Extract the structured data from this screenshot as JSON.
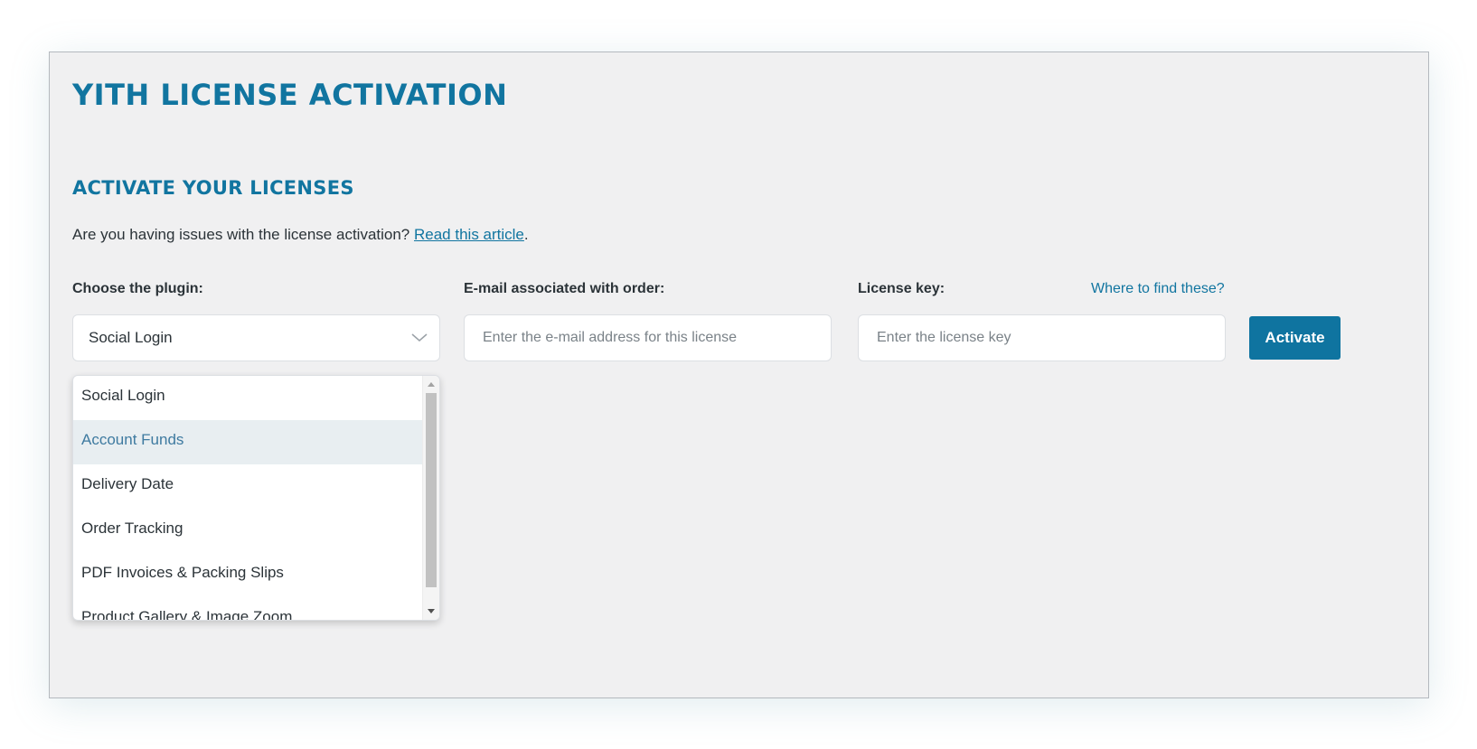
{
  "page": {
    "title": "YITH LICENSE ACTIVATION",
    "section_title": "ACTIVATE YOUR LICENSES",
    "help_text": "Are you having issues with the license activation?",
    "help_link_label": "Read this article",
    "help_suffix": "."
  },
  "form": {
    "plugin_label": "Choose the plugin:",
    "plugin_selected": "Social Login",
    "email_label": "E-mail associated with order:",
    "email_placeholder": "Enter the e-mail address for this license",
    "email_value": "",
    "key_label": "License key:",
    "key_placeholder": "Enter the license key",
    "key_value": "",
    "where_link": "Where to find these?",
    "activate_label": "Activate"
  },
  "dropdown": {
    "options": [
      "Social Login",
      "Account Funds",
      "Delivery Date",
      "Order Tracking",
      "PDF Invoices & Packing Slips",
      "Product Gallery & Image Zoom"
    ],
    "highlighted_index": 1
  },
  "colors": {
    "accent": "#1175a0",
    "button": "#0f74a0",
    "panel_background": "#f0f0f1",
    "highlight_background": "#e8eef1"
  },
  "icons": {
    "select_arrow": "chevron-down-icon",
    "scroll_up": "scroll-up-arrow-icon",
    "scroll_down": "scroll-down-arrow-icon"
  }
}
